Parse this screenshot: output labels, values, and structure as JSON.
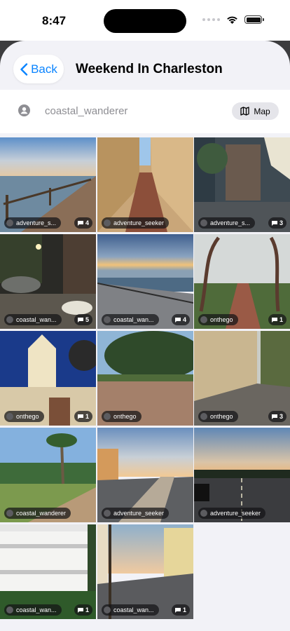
{
  "status": {
    "time": "8:47"
  },
  "header": {
    "back_label": "Back",
    "title": "Weekend In Charleston"
  },
  "user": {
    "name": "coastal_wanderer",
    "map_label": "Map"
  },
  "photos": [
    {
      "user": "adventure_s...",
      "comments": "4",
      "scene": "waterfront-sunset"
    },
    {
      "user": "adventure_seeker",
      "comments": "",
      "scene": "narrow-alley"
    },
    {
      "user": "adventure_s...",
      "comments": "3",
      "scene": "sunlit-street"
    },
    {
      "user": "coastal_wan...",
      "comments": "5",
      "scene": "night-crowd"
    },
    {
      "user": "coastal_wan...",
      "comments": "4",
      "scene": "battery-promenade"
    },
    {
      "user": "onthego",
      "comments": "1",
      "scene": "oak-path"
    },
    {
      "user": "onthego",
      "comments": "1",
      "scene": "church-tower"
    },
    {
      "user": "onthego",
      "comments": "",
      "scene": "park-oaks"
    },
    {
      "user": "onthego",
      "comments": "3",
      "scene": "cobblestone-street"
    },
    {
      "user": "coastal_wanderer",
      "comments": "",
      "scene": "palm-park"
    },
    {
      "user": "adventure_seeker",
      "comments": "",
      "scene": "seawall-walk"
    },
    {
      "user": "adventure_seeker",
      "comments": "",
      "scene": "dusk-road"
    },
    {
      "user": "coastal_wan...",
      "comments": "1",
      "scene": "white-mansion"
    },
    {
      "user": "coastal_wan...",
      "comments": "1",
      "scene": "king-street"
    }
  ]
}
